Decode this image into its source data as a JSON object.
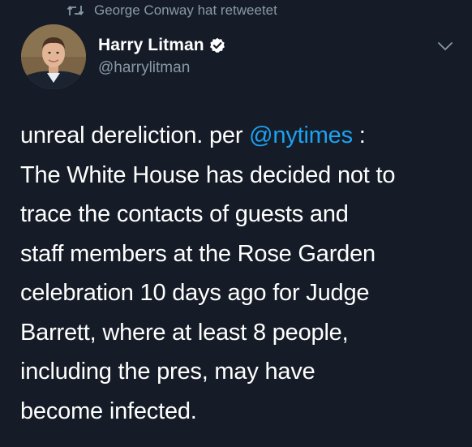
{
  "retweet": {
    "text": "George Conway hat retweetet"
  },
  "author": {
    "name": "Harry Litman",
    "handle": "@harrylitman",
    "verified": true
  },
  "tweet": {
    "lines": [
      {
        "before": "unreal dereliction.  per ",
        "mention": "@nytimes",
        "after": " :"
      },
      {
        "text": "The White House has decided not to"
      },
      {
        "text": "trace the contacts of guests and"
      },
      {
        "text": "staff members at the Rose Garden"
      },
      {
        "text": "celebration 10 days ago for Judge"
      },
      {
        "text": "Barrett, where at least 8 people,"
      },
      {
        "text": "including the pres, may have"
      },
      {
        "text": "become infected."
      }
    ]
  },
  "colors": {
    "background": "#151c27",
    "secondary_text": "#8899a6",
    "accent": "#1da1f2",
    "primary_text": "#ffffff"
  },
  "icons": {
    "retweet": "retweet-icon",
    "verified": "verified-badge-icon",
    "menu": "chevron-down-icon"
  }
}
